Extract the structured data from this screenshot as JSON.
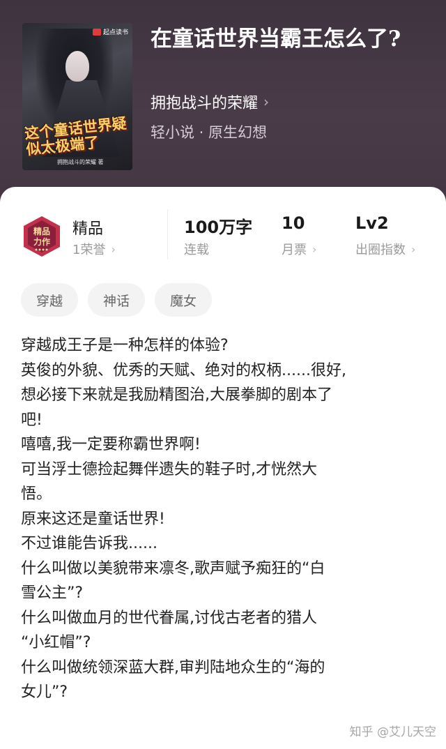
{
  "book": {
    "title": "在童话世界当霸王怎么了?",
    "author": "拥抱战斗的荣耀",
    "genre": "轻小说 · 原生幻想",
    "cover": {
      "publisher": "起点读书",
      "title": "这个童话世界疑似太极端了",
      "author": "拥抱战斗的荣耀 著"
    }
  },
  "stats": {
    "quality": {
      "value": "精品",
      "sub": "1荣誉"
    },
    "words": {
      "value": "100万字",
      "sub": "连载"
    },
    "tickets": {
      "value": "10",
      "sub": "月票"
    },
    "level": {
      "value": "Lv2",
      "sub": "出圈指数"
    }
  },
  "badge_text": "精品力作",
  "tags": [
    "穿越",
    "神话",
    "魔女"
  ],
  "description": [
    "穿越成王子是一种怎样的体验?",
    "英俊的外貌、优秀的天赋、绝对的权柄......很好,",
    "想必接下来就是我励精图治,大展拳脚的剧本了",
    "吧!",
    "嘻嘻,我一定要称霸世界啊!",
    "可当浮士德捡起舞伴遗失的鞋子时,才恍然大",
    "悟。",
    "原来这还是童话世界!",
    "不过谁能告诉我......",
    "什么叫做以美貌带来凛冬,歌声赋予痴狂的“白",
    "雪公主”?",
    "什么叫做血月的世代眷属,讨伐古老者的猎人",
    "“小红帽”?",
    "什么叫做统领深蓝大群,审判陆地众生的“海的",
    "女儿”?"
  ],
  "watermark": "知乎 @艾儿天空",
  "colors": {
    "header_bg": "#45374a",
    "badge_red": "#c2304a",
    "tag_bg": "#f3f3f3"
  },
  "icons": [
    "chevron-right-icon",
    "quality-badge-icon"
  ]
}
